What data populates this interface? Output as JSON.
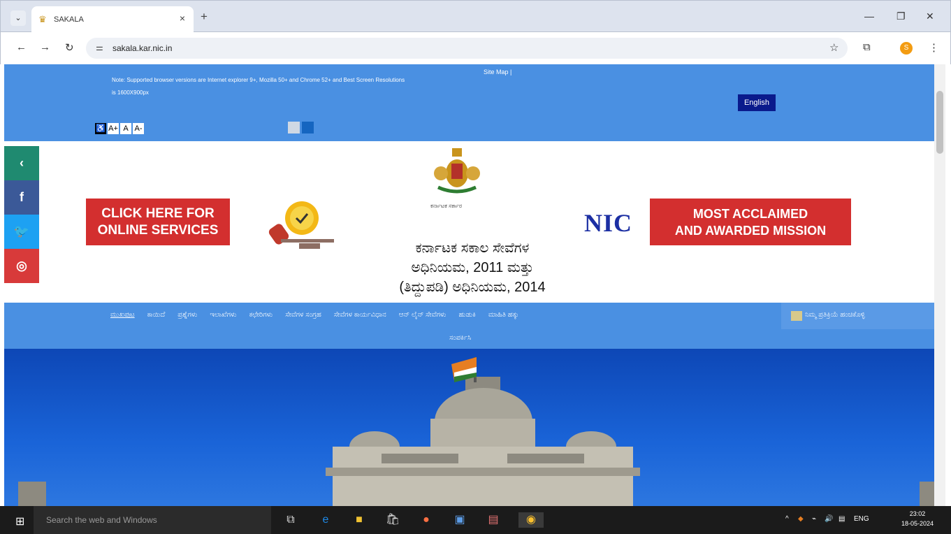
{
  "browser": {
    "tab_title": "SAKALA",
    "url": "sakala.kar.nic.in",
    "profile_initial": "S"
  },
  "page": {
    "note": "Note: Supported browser versions are Internet explorer 9+, Mozilla 50+ and Chrome 52+ and Best Screen Resolutions is 1600X900px",
    "sitemap": "Site Map |",
    "language_button": "English",
    "font_sizes": [
      "A+",
      "A",
      "A-"
    ],
    "theme_colors": [
      "#4a90e2",
      "#cfd8e4",
      "#1565c0"
    ],
    "social": [
      {
        "label": "‹",
        "color": "#1f8a70"
      },
      {
        "label": "f",
        "color": "#3b5998"
      },
      {
        "label": "🐦",
        "color": "#1da1f2"
      },
      {
        "label": "◎",
        "color": "#d83a3a"
      }
    ],
    "emblem_caption": "ಕರ್ನಾಟಕ ಸರ್ಕಾರ",
    "online_services_line1": "CLICK HERE FOR",
    "online_services_line2": "ONLINE SERVICES",
    "nic_logo": "NIC",
    "mission_line1": "MOST ACCLAIMED",
    "mission_line2": "AND AWARDED MISSION",
    "title_line1": "ಕರ್ನಾಟಕ ಸಕಾಲ ಸೇವೆಗಳ",
    "title_line2": "ಅಧಿನಿಯಮ, 2011 ಮತ್ತು",
    "title_line3": "(ತಿದ್ದುಪಡಿ) ಅಧಿನಿಯಮ, 2014",
    "nav_items": [
      "ಮುಖಪುಟ",
      "ಕಾಯಿದೆ",
      "ಪ್ರಶ್ನೆಗಳು",
      "ಇಲಾಖೆಗಳು",
      "ಕಛೇರಿಗಳು",
      "ಸೇವೆಗಳ ಸಂಗ್ರಹ",
      "ಸೇವೆಗಳ ಕಾರ್ಯವಿಧಾನ",
      "ಆನ್ ಲೈನ್ ಸೇವೆಗಳು",
      "ಹುಡುಕಿ",
      "ಮಾಹಿತಿ ಹಕ್ಕು"
    ],
    "feedback": "ನಿಮ್ಮ ಪ್ರತಿಕ್ರಿಯೆ ಹಂಚಿಕೊಳ್ಳಿ",
    "contact": "ಸಂಪರ್ಕಿಸಿ"
  },
  "taskbar": {
    "search_placeholder": "Search the web and Windows",
    "lang": "ENG",
    "time": "23:02",
    "date": "18-05-2024"
  }
}
